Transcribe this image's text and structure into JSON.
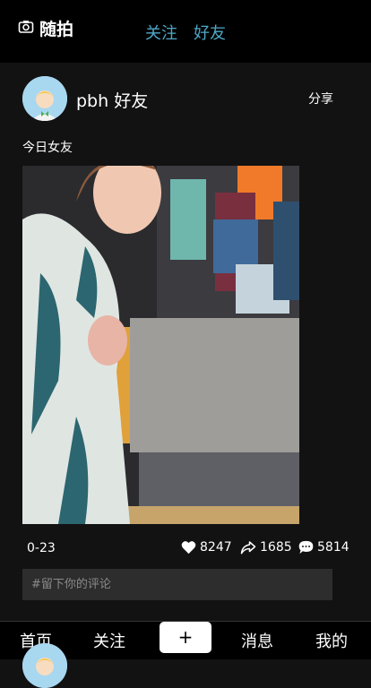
{
  "header": {
    "camera_icon": "camera-icon",
    "title": "随拍",
    "tabs": [
      {
        "label": "关注"
      },
      {
        "label": "好友"
      }
    ],
    "tab_color": "#4fa8c8"
  },
  "post": {
    "author": "pbh 好友",
    "share_label": "分享",
    "caption": "今日女友",
    "date": "0-23",
    "likes": "8247",
    "shares": "1685",
    "comments": "5814",
    "comment_placeholder": "#留下你的评论"
  },
  "nav": {
    "items": [
      {
        "label": "首页"
      },
      {
        "label": "关注"
      },
      {
        "label": "+"
      },
      {
        "label": "消息"
      },
      {
        "label": "我的"
      }
    ]
  }
}
